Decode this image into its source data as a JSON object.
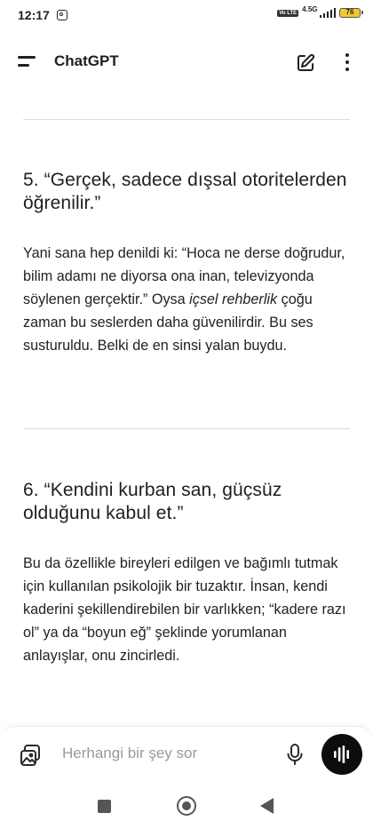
{
  "status_bar": {
    "time": "12:17",
    "network": "4.5G",
    "volte": "Vo LTE",
    "battery": "76"
  },
  "app_bar": {
    "title": "ChatGPT"
  },
  "content": {
    "section5": {
      "heading": "5. “Gerçek, sadece dışsal otoritelerden öğrenilir.”",
      "paragraph_before_italic": "Yani sana hep denildi ki: “Hoca ne derse doğrudur, bilim adamı ne diyorsa ona inan, televizyonda söylenen gerçektir.” Oysa ",
      "paragraph_italic": "içsel rehberlik",
      "paragraph_after_italic": " çoğu zaman bu seslerden daha güvenilirdir. Bu ses susturuldu. Belki de en sinsi yalan buydu."
    },
    "section6": {
      "heading": "6. “Kendini kurban san, güçsüz olduğunu kabul et.”",
      "paragraph": "Bu da özellikle bireyleri edilgen ve bağımlı tutmak için kullanılan psikolojik bir tuzaktır. İnsan, kendi kaderini şekillendirebilen bir varlıkken; “kadere razı ol” ya da “boyun eğ” şeklinde yorumlanan anlayışlar, onu zincirledi."
    }
  },
  "composer": {
    "placeholder": "Herhangi bir şey sor"
  },
  "icons": {
    "menu": "menu-icon",
    "compose": "new-chat-icon",
    "more": "more-vertical-icon",
    "attach": "image-attach-icon",
    "mic": "microphone-icon",
    "voice": "voice-mode-icon",
    "nav_recents": "recents-icon",
    "nav_home": "home-icon",
    "nav_back": "back-icon"
  },
  "colors": {
    "text": "#1f1f1f",
    "placeholder": "#9a9a9a",
    "voice_button": "#0d0d0d",
    "battery": "#f3c733"
  }
}
